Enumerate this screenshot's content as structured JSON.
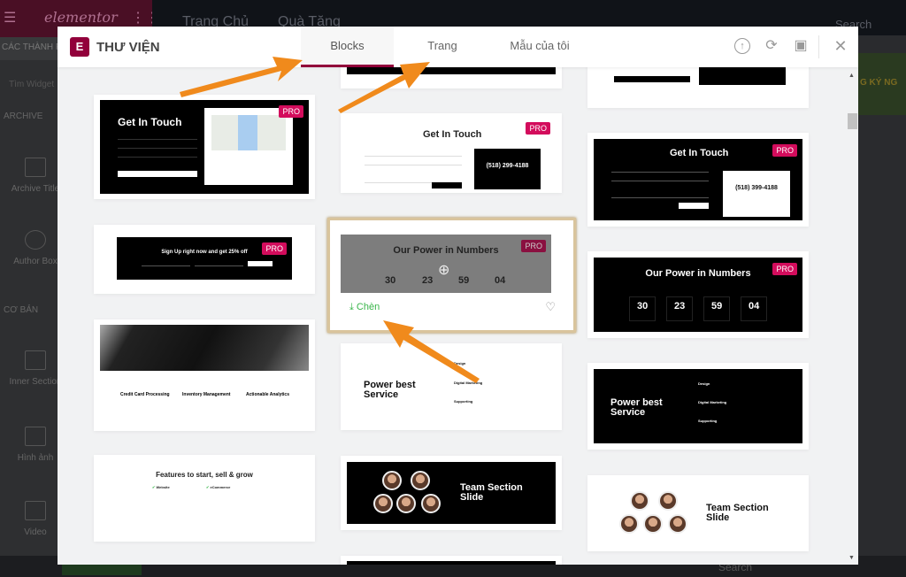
{
  "background": {
    "panel": {
      "logo": "elementor",
      "tab_label": "CÁC THÀNH PH",
      "search_placeholder": "Tìm Widget",
      "sections": [
        "ARCHIVE",
        "CƠ BẢN"
      ],
      "widgets": [
        "Archive Title",
        "Author Box",
        "Inner Section",
        "Hình ảnh",
        "Video"
      ]
    },
    "topbar": {
      "links": [
        "Trang Chủ",
        "Quà Tặng"
      ],
      "search_placeholder": "Search",
      "banner": "G KÝ NG"
    },
    "bottom_search": "Search"
  },
  "modal": {
    "title": "THƯ VIỆN",
    "logo_letter": "E",
    "tabs": [
      {
        "label": "Blocks",
        "active": true
      },
      {
        "label": "Trang",
        "active": false
      },
      {
        "label": "Mẫu của tôi",
        "active": false
      }
    ],
    "header_icons": [
      "upload-icon",
      "sync-icon",
      "save-icon",
      "close-icon"
    ],
    "accent_color": "#92003b",
    "pro_badge": "PRO",
    "pro_color": "#d30c5c",
    "insert_label": "Chèn",
    "insert_color": "#39b54a",
    "blocks": {
      "col1": [
        {
          "title": "Get In Touch",
          "pro": true
        },
        {
          "title": "Sign Up right now and get 25% off",
          "pro": true
        },
        {
          "features": [
            "Credit Card Processing",
            "Inventory Management",
            "Actionable Analytics"
          ]
        },
        {
          "title": "Features to start, sell & grow",
          "lists": [
            "Website",
            "eCommerce"
          ]
        }
      ],
      "col2": [
        {
          "title": "Get In Touch",
          "phone": "(518) 299-4188",
          "pro": true
        },
        {
          "title": "Our Power in Numbers",
          "numbers": [
            "30",
            "23",
            "59",
            "04"
          ],
          "pro": true,
          "hovered": true
        },
        {
          "title": "Power best Service",
          "items": [
            "Design",
            "Digital Marketing",
            "Supporting"
          ]
        },
        {
          "title": "Team Section Slide"
        }
      ],
      "col3": [
        {
          "title": "Get In Touch",
          "phone": "(518) 399-4188",
          "pro": true
        },
        {
          "title": "Our Power in Numbers",
          "numbers": [
            "30",
            "23",
            "59",
            "04"
          ],
          "pro": true
        },
        {
          "title": "Power best Service",
          "items": [
            "Design",
            "Digital Marketing",
            "Supporting"
          ]
        },
        {
          "title": "Team Section Slide"
        }
      ]
    }
  },
  "annotation_color": "#f08a1c"
}
